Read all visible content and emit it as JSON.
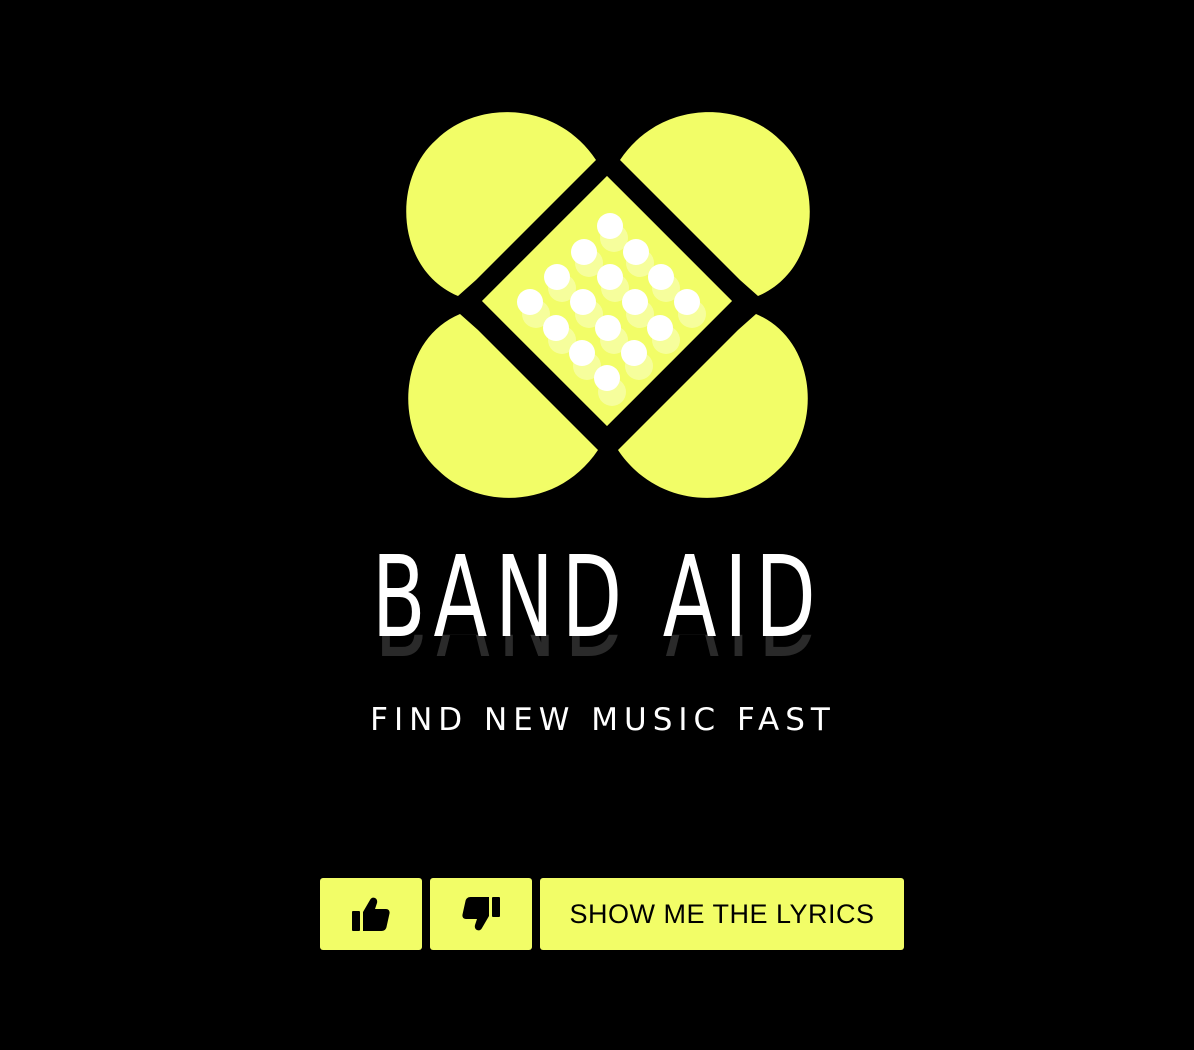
{
  "brand": {
    "name": "BAND AID",
    "tagline": "FIND NEW MUSIC FAST"
  },
  "colors": {
    "background": "#000000",
    "accent": "#f2fd67",
    "text": "#ffffff"
  },
  "controls": {
    "like_icon": "thumbs-up-icon",
    "dislike_icon": "thumbs-down-icon",
    "lyrics_label": "SHOW ME THE LYRICS"
  }
}
